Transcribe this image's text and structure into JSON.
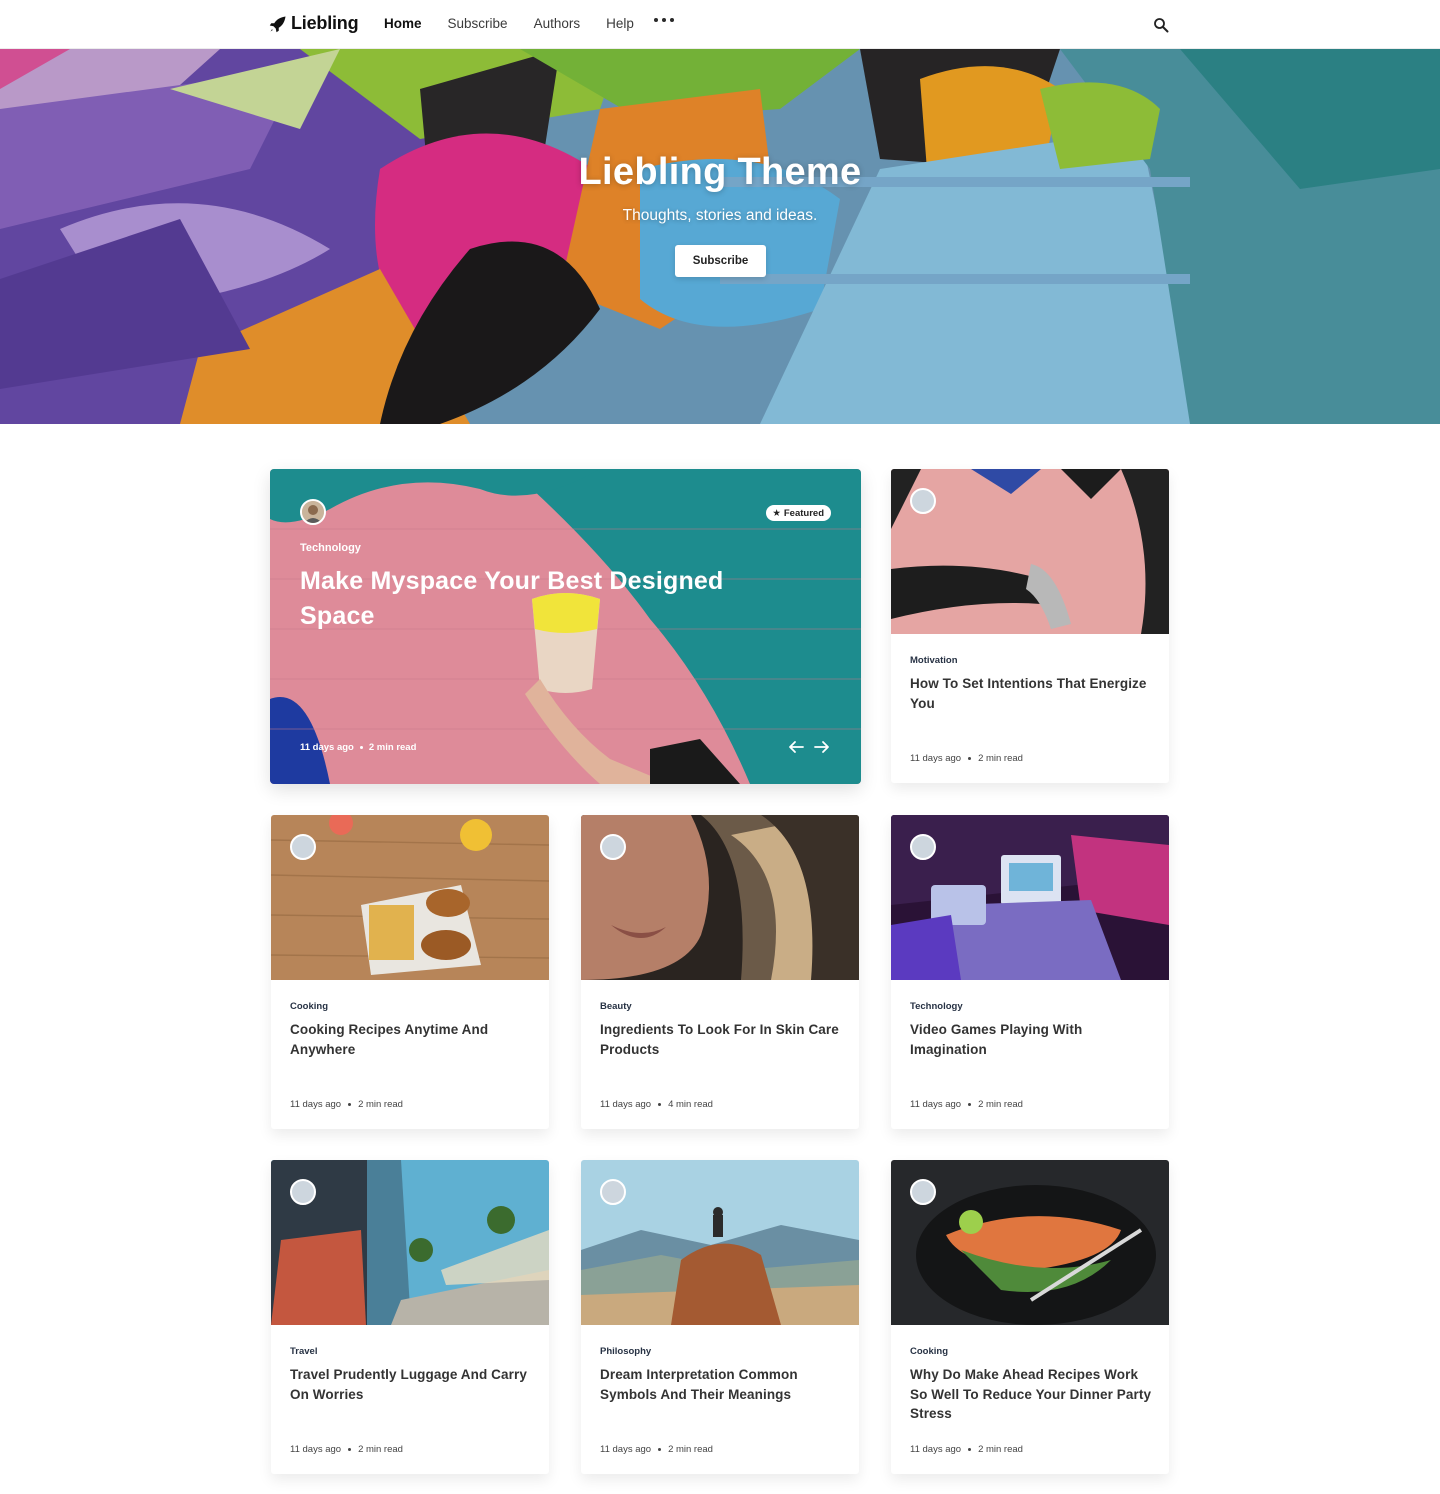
{
  "header": {
    "logo": "Liebling",
    "nav": [
      "Home",
      "Subscribe",
      "Authors",
      "Help"
    ],
    "active_nav": "Home"
  },
  "hero": {
    "title": "Liebling Theme",
    "subtitle": "Thoughts, stories and ideas.",
    "button": "Subscribe"
  },
  "featured": {
    "badge": "Featured",
    "tag": "Technology",
    "title": "Make Myspace Your Best Designed Space",
    "date": "11 days ago",
    "read": "2 min read"
  },
  "cards": [
    {
      "tag": "Motivation",
      "title": "How To Set Intentions That Energize You",
      "date": "11 days ago",
      "read": "2 min read"
    },
    {
      "tag": "Cooking",
      "title": "Cooking Recipes Anytime And Anywhere",
      "date": "11 days ago",
      "read": "2 min read"
    },
    {
      "tag": "Beauty",
      "title": "Ingredients To Look For In Skin Care Products",
      "date": "11 days ago",
      "read": "4 min read"
    },
    {
      "tag": "Technology",
      "title": "Video Games Playing With Imagination",
      "date": "11 days ago",
      "read": "2 min read"
    },
    {
      "tag": "Travel",
      "title": "Travel Prudently Luggage And Carry On Worries",
      "date": "11 days ago",
      "read": "2 min read"
    },
    {
      "tag": "Philosophy",
      "title": "Dream Interpretation Common Symbols And Their Meanings",
      "date": "11 days ago",
      "read": "2 min read"
    },
    {
      "tag": "Cooking",
      "title": "Why Do Make Ahead Recipes Work So Well To Reduce Your Dinner Party Stress",
      "date": "11 days ago",
      "read": "2 min read"
    }
  ]
}
